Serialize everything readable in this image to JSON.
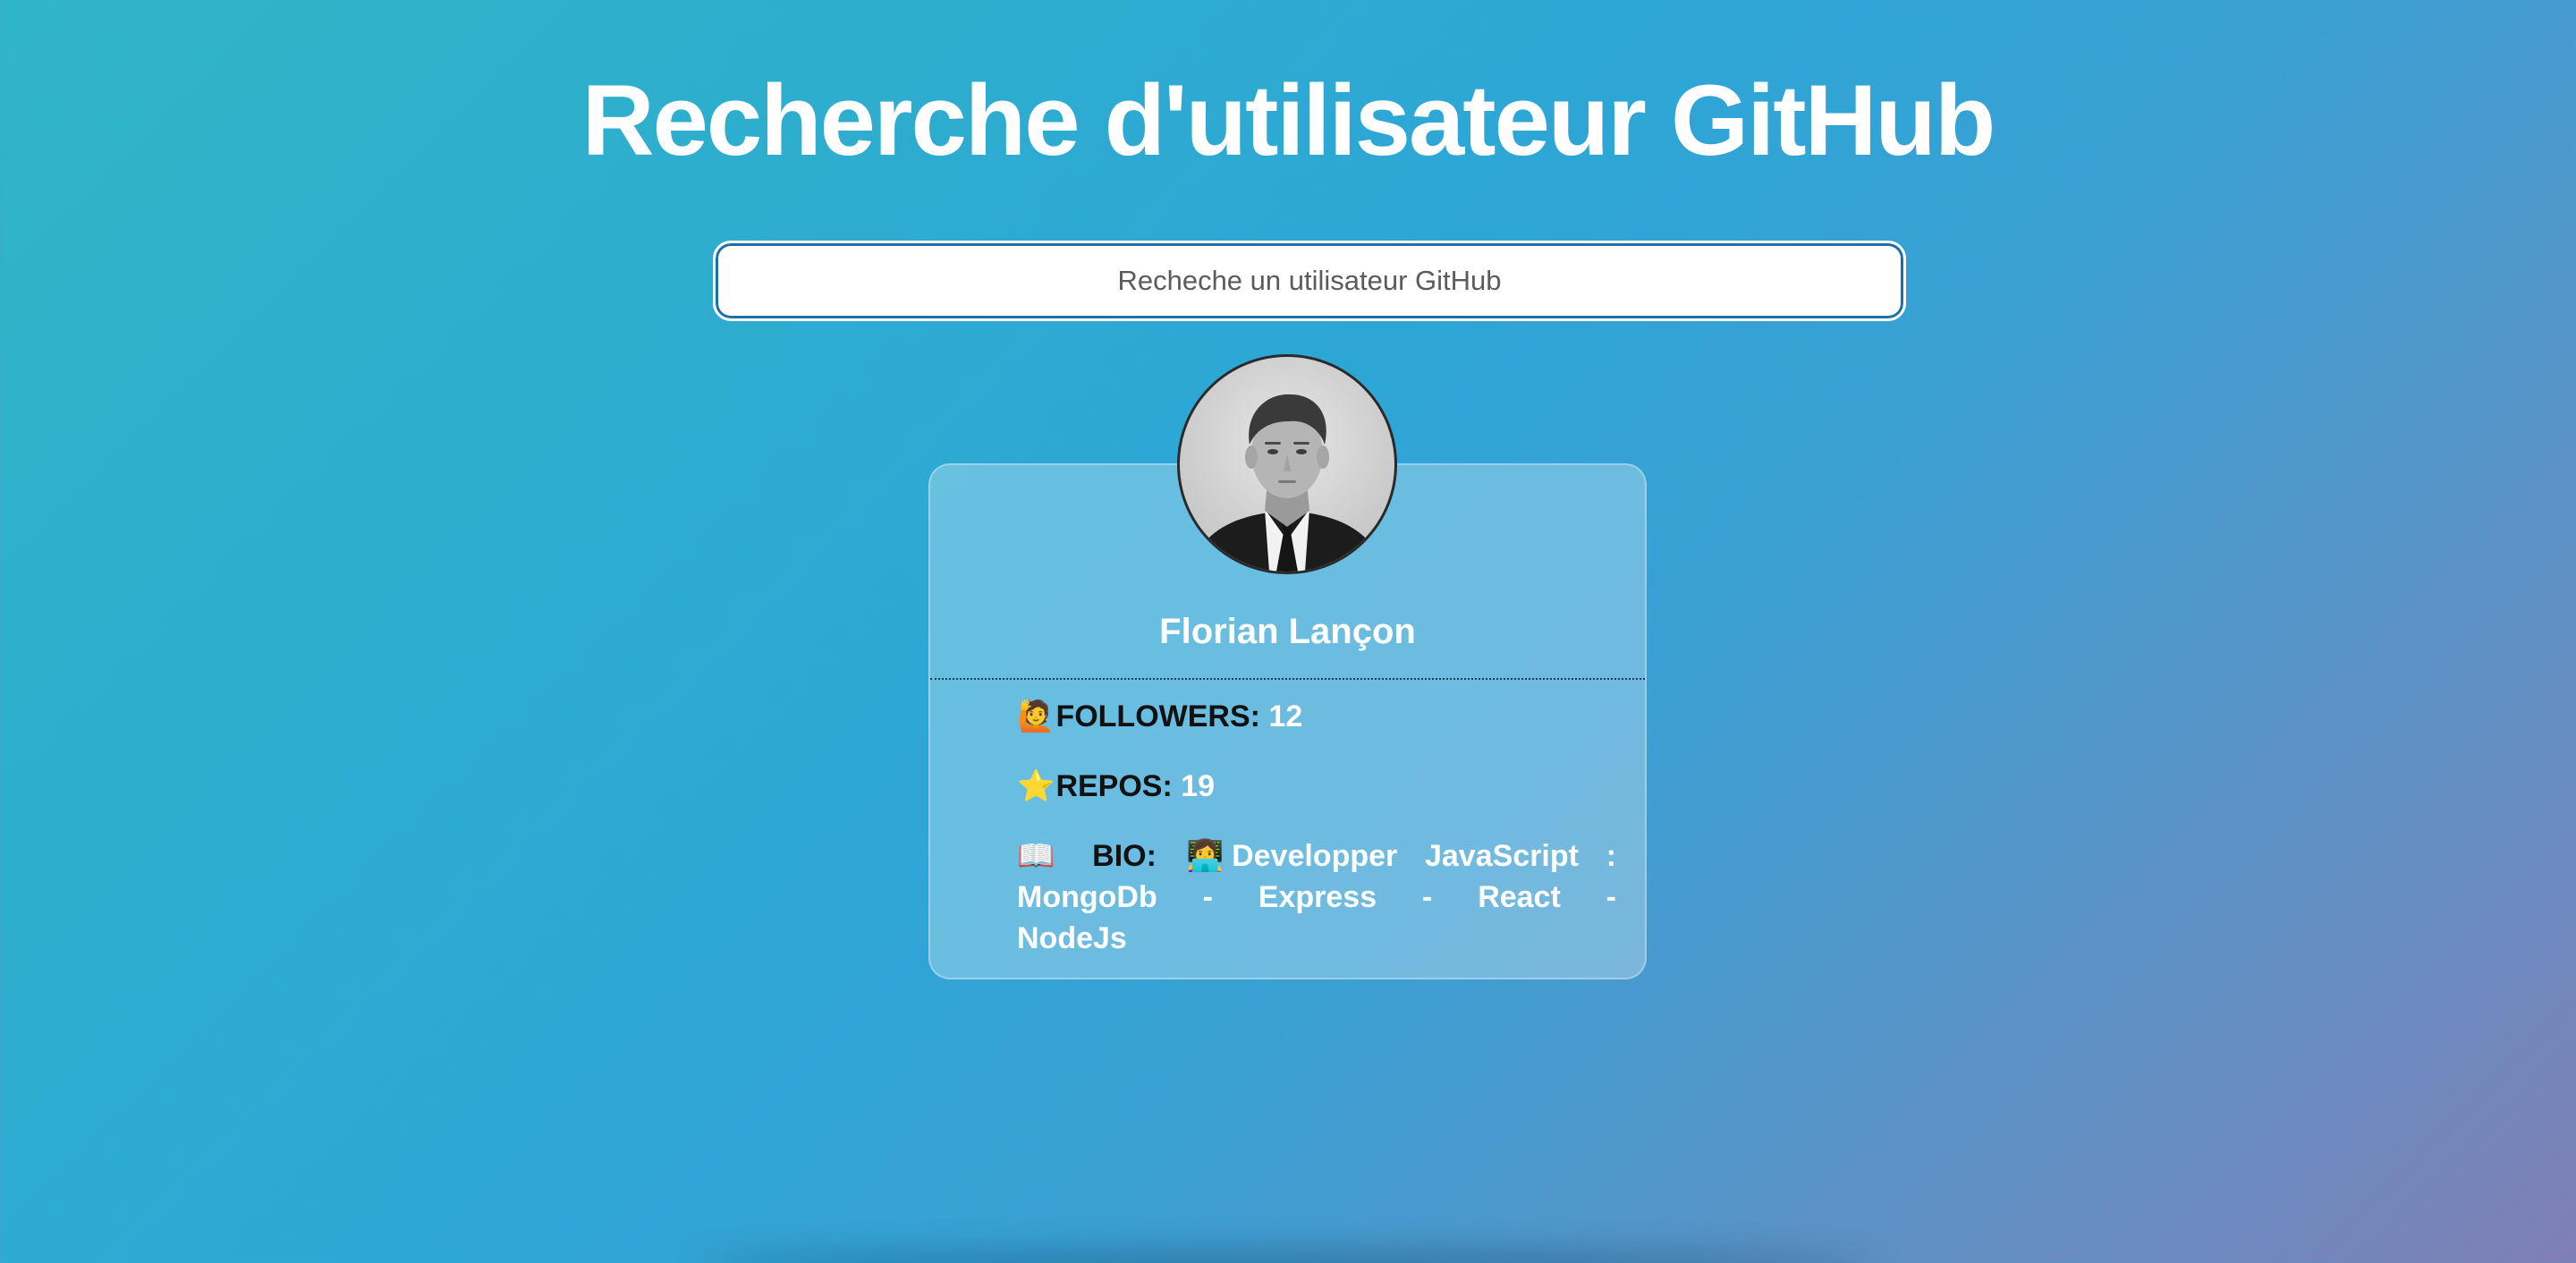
{
  "header": {
    "title": "Recherche d'utilisateur GitHub"
  },
  "search": {
    "placeholder": "Recheche un utilisateur GitHub",
    "value": ""
  },
  "profile": {
    "name": "Florian Lançon",
    "followers": {
      "icon": "🙋",
      "label": "FOLLOWERS:",
      "value": "12"
    },
    "repos": {
      "icon": "⭐",
      "label": "REPOS:",
      "value": "19"
    },
    "bio": {
      "icon": "📖",
      "label": "BIO:",
      "value_icon": "👩‍💻",
      "value": "Developper JavaScript : MongoDb - Express - React - NodeJs"
    }
  },
  "colors": {
    "gradient_start": "#2fb6c6",
    "gradient_end": "#7f7fb5",
    "title": "#ffffff",
    "label": "#111111"
  }
}
